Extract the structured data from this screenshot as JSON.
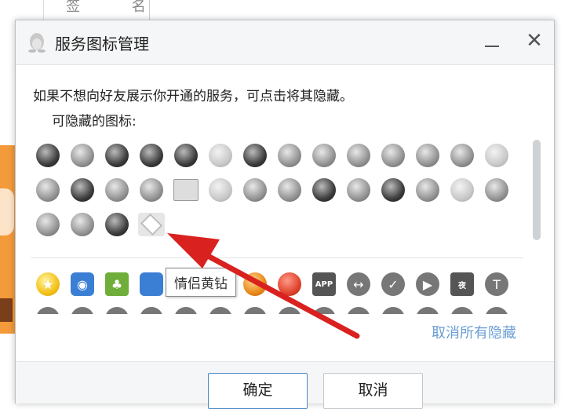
{
  "background": {
    "behind_label": "签 名"
  },
  "dialog": {
    "title": "服务图标管理",
    "minimize_glyph": "",
    "close_glyph": "✕",
    "intro_text": "如果不想向好友展示你开通的服务，可点击将其隐藏。",
    "hidden_label": "可隐藏的图标:",
    "hidden_icons": [
      {
        "name": "flame-badge-icon",
        "style": "dark"
      },
      {
        "name": "heart-badge-icon",
        "style": "gray"
      },
      {
        "name": "penguin-badge-icon",
        "style": "dark"
      },
      {
        "name": "diamond-dark-icon",
        "style": "dark"
      },
      {
        "name": "penguin-dark-icon",
        "style": "dark"
      },
      {
        "name": "lightning-gem-icon",
        "style": "light"
      },
      {
        "name": "game-badge-icon",
        "style": "dark"
      },
      {
        "name": "crown-gem-icon",
        "style": "gray"
      },
      {
        "name": "heart-gem-icon",
        "style": "gray"
      },
      {
        "name": "diamond-gray-icon",
        "style": "gray"
      },
      {
        "name": "diamond-gray-2-icon",
        "style": "gray"
      },
      {
        "name": "diamond-gray-3-icon",
        "style": "gray"
      },
      {
        "name": "diamond-level-icon",
        "style": "gray"
      },
      {
        "name": "v-badge-icon",
        "style": "light"
      },
      {
        "name": "s-badge-icon",
        "style": "gray"
      },
      {
        "name": "heart-dark-icon",
        "style": "dark"
      },
      {
        "name": "shield-badge-icon",
        "style": "gray"
      },
      {
        "name": "diamond-dark-2-icon",
        "style": "gray"
      },
      {
        "name": "book-icon",
        "style": "book"
      },
      {
        "name": "diamond-light-icon",
        "style": "light"
      },
      {
        "name": "wings-gem-icon",
        "style": "gray"
      },
      {
        "name": "diamond-level-2-icon",
        "style": "gray"
      },
      {
        "name": "gear-gem-icon",
        "style": "dark"
      },
      {
        "name": "diamond-gray-4-icon",
        "style": "gray"
      },
      {
        "name": "dragon-badge-icon",
        "style": "dark"
      },
      {
        "name": "diamond-gray-5-icon",
        "style": "gray"
      },
      {
        "name": "cloud-v-icon",
        "style": "light"
      },
      {
        "name": "music-circle-icon",
        "style": "gray"
      },
      {
        "name": "lightning-circle-icon",
        "style": "gray"
      },
      {
        "name": "pen-icon",
        "style": "gray"
      },
      {
        "name": "star-dark-icon",
        "style": "dark"
      },
      {
        "name": "couple-yellow-diamond-icon",
        "style": "selected"
      }
    ],
    "tooltip": "情侣黄钻",
    "shown_icons": [
      {
        "name": "star-yellow-icon",
        "style": "c-yellow",
        "glyph": "★"
      },
      {
        "name": "camera-icon",
        "style": "c-blue",
        "glyph": "◉"
      },
      {
        "name": "plant-icon",
        "style": "c-green",
        "glyph": "♣"
      },
      {
        "name": "blue-circle-icon",
        "style": "c-blue",
        "glyph": ""
      },
      {
        "name": "hidden-under-tooltip-1-icon",
        "style": "c-gray2",
        "glyph": ""
      },
      {
        "name": "hidden-under-tooltip-2-icon",
        "style": "c-gray2",
        "glyph": ""
      },
      {
        "name": "gold-badge-icon",
        "style": "c-orange",
        "glyph": ""
      },
      {
        "name": "character-icon",
        "style": "c-red",
        "glyph": ""
      },
      {
        "name": "app-icon",
        "style": "c-darkgray",
        "glyph": "APP"
      },
      {
        "name": "arrow-gem-icon",
        "style": "c-gray2",
        "glyph": "↔"
      },
      {
        "name": "shield-v-icon",
        "style": "c-gray2",
        "glyph": "✓"
      },
      {
        "name": "video-icon",
        "style": "c-gray2",
        "glyph": "▶"
      },
      {
        "name": "night-icon",
        "style": "c-darkgray",
        "glyph": "夜"
      },
      {
        "name": "t-shield-icon",
        "style": "c-gray2",
        "glyph": "T"
      }
    ],
    "unhide_all_link": "取消所有隐藏",
    "ok_button": "确定",
    "cancel_button": "取消"
  },
  "colors": {
    "arrow": "#d9211f",
    "link": "#6b9ed4",
    "primary_border": "#4d86c6"
  }
}
